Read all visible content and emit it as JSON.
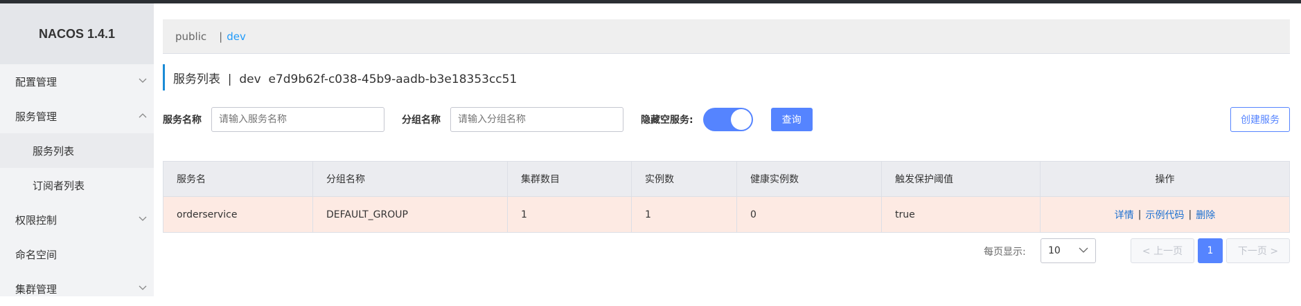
{
  "app": {
    "brand": "NACOS 1.4.1"
  },
  "sidebar": {
    "items": [
      {
        "label": "配置管理",
        "icon": "chevron-down-icon"
      },
      {
        "label": "服务管理",
        "icon": "chevron-up-icon"
      },
      {
        "label": "服务列表"
      },
      {
        "label": "订阅者列表"
      },
      {
        "label": "权限控制",
        "icon": "chevron-down-icon"
      },
      {
        "label": "命名空间"
      },
      {
        "label": "集群管理",
        "icon": "chevron-down-icon"
      }
    ]
  },
  "namespaces": {
    "public": "public",
    "separator": "|",
    "dev": "dev"
  },
  "page": {
    "title": "服务列表  |  dev  e7d9b62f-c038-45b9-aadb-b3e18353cc51"
  },
  "filters": {
    "service_name_label": "服务名称",
    "service_name_placeholder": "请输入服务名称",
    "group_name_label": "分组名称",
    "group_name_placeholder": "请输入分组名称",
    "hide_empty_label": "隐藏空服务:",
    "hide_empty_on": true,
    "query_button": "查询",
    "create_button": "创建服务"
  },
  "table": {
    "columns": [
      "服务名",
      "分组名称",
      "集群数目",
      "实例数",
      "健康实例数",
      "触发保护阈值",
      "操作"
    ],
    "rows": [
      {
        "service": "orderservice",
        "group": "DEFAULT_GROUP",
        "clusters": "1",
        "instances": "1",
        "healthy": "0",
        "threshold": "true",
        "actions": {
          "detail": "详情",
          "sample": "示例代码",
          "delete": "删除",
          "sep": "|"
        }
      }
    ]
  },
  "pagination": {
    "page_size_label": "每页显示:",
    "page_size": "10",
    "prev": "< 上一页",
    "current": "1",
    "next": "下一页 >"
  },
  "colors": {
    "primary": "#5584ff",
    "link": "#1a6fd0",
    "row_highlight": "#fdeae3"
  }
}
